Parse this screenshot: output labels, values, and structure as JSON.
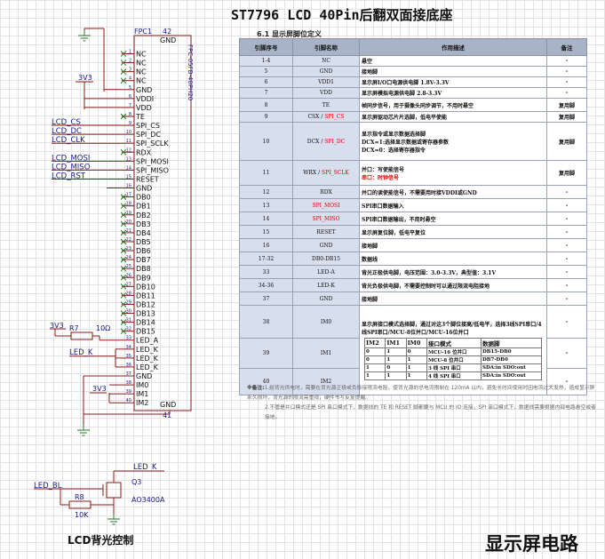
{
  "title": "ST7796 LCD 40Pin后翻双面接底座",
  "section_heading": "6.1 显示屏脚位定义",
  "table": {
    "headers": [
      "引脚序号",
      "引脚名称",
      "作用描述",
      "备注"
    ],
    "rows": [
      {
        "pin": "1-4",
        "name": "NC",
        "name_suffix": "",
        "desc": [
          "悬空"
        ],
        "note": "-"
      },
      {
        "pin": "5",
        "name": "GND",
        "name_suffix": "",
        "desc": [
          "接地脚"
        ],
        "note": "-"
      },
      {
        "pin": "6",
        "name": "VDD1",
        "name_suffix": "",
        "desc": [
          "显示屏I/O口电源供电脚 1.8V-3.3V"
        ],
        "note": "-"
      },
      {
        "pin": "7",
        "name": "VDD",
        "name_suffix": "",
        "desc": [
          "显示屏模拟电源供电脚 2.8-3.3V"
        ],
        "note": "-"
      },
      {
        "pin": "8",
        "name": "TE",
        "name_suffix": "",
        "desc": [
          "帧同步信号，用于摄像头同步调节，不用时悬空"
        ],
        "note": "复用脚"
      },
      {
        "pin": "9",
        "name": "CSX /",
        "name_suffix": " SPI_CS",
        "desc": [
          "显示屏驱动芯片片选脚，低电平使能"
        ],
        "note": "复用脚"
      },
      {
        "pin": "10",
        "name": "DCX /",
        "name_suffix": " SPI_DC",
        "desc": [
          "显示指令或显示数据选择脚",
          "DCX=1:选择显示数据或寄存器参数",
          "DCX=0：选择寄存器指令"
        ],
        "note": "复用脚"
      },
      {
        "pin": "11",
        "name": "WRX /",
        "name_suffix": " SPI_SCLK",
        "desc": [
          "并口：写使能信号",
          "串口：时钟信号"
        ],
        "note": "复用脚"
      },
      {
        "pin": "12",
        "name": "RDX",
        "name_suffix": "",
        "desc": [
          "并口的读使能信号，不需要用时接VDDI或GND"
        ],
        "note": "-"
      },
      {
        "pin": "13",
        "name": "SPI_MOSI",
        "name_suffix": "",
        "desc": [
          "SPI串口数据输入"
        ],
        "note": "-"
      },
      {
        "pin": "14",
        "name": "SPI_MISO",
        "name_suffix": "",
        "desc": [
          "SPI串口数据输出，不用时悬空"
        ],
        "note": "-"
      },
      {
        "pin": "15",
        "name": "RESET",
        "name_suffix": "",
        "desc": [
          "显示屏复位脚，低电平复位"
        ],
        "note": "-"
      },
      {
        "pin": "16",
        "name": "GND",
        "name_suffix": "",
        "desc": [
          "接地脚"
        ],
        "note": "-"
      },
      {
        "pin": "17-32",
        "name": "DB0-DB15",
        "name_suffix": "",
        "desc": [
          "数据线"
        ],
        "note": "-"
      },
      {
        "pin": "33",
        "name": "LED-A",
        "name_suffix": "",
        "desc": [
          "背光正极供电脚，电压范围：3.0-3.3V，典型值：3.1V"
        ],
        "note": "-"
      },
      {
        "pin": "34-36",
        "name": "LED-K",
        "name_suffix": "",
        "desc": [
          "背光负极供电脚，不需要控制时可以通过限流电阻接地"
        ],
        "note": "-"
      },
      {
        "pin": "37",
        "name": "GND",
        "name_suffix": "",
        "desc": [
          "接地脚"
        ],
        "note": "-"
      },
      {
        "pin": "38",
        "name": "IM0",
        "name_suffix": "",
        "desc": [
          "显示屏接口模式选择脚，通过对这3个脚位接高/低电平，选择3线SPI串口/4线SPI串口/MCU-8位并口/MCU-16位并口"
        ],
        "note": "-"
      },
      {
        "pin": "39",
        "name": "IM1",
        "name_suffix": "",
        "desc": [],
        "note": "-"
      },
      {
        "pin": "40",
        "name": "IM2",
        "name_suffix": "",
        "desc": [],
        "note": "-"
      }
    ],
    "im_headers": [
      "IM2",
      "IM1",
      "IM0",
      "接口模式",
      "数据脚"
    ],
    "im_rows": [
      [
        "0",
        "1",
        "0",
        "MCU-16 位并口",
        "DB15-DB0"
      ],
      [
        "0",
        "1",
        "1",
        "MCU-8 位并口",
        "DB7-DB0"
      ],
      [
        "1",
        "0",
        "1",
        "3 线 SPI 串口",
        "SDA:in    SDO:out"
      ],
      [
        "1",
        "1",
        "1",
        "4 线 SPI 串口",
        "SDA:in    SDO:out"
      ]
    ]
  },
  "notes": {
    "label": "※备注:",
    "n1": "1.给背光供电时，需要在背光源正极或负极接限流电阻，使背光源的总电流限制在 120mA 以内，避免长时间使用时因电流过大发热，造成显示屏永久损坏，背光源的限流需重视，硬件书写反复提醒。",
    "n2": "2.不管是并口模式还是 SPI 串口模式下，数据线的 TE 和 RESET 脚都要与 MCU 的 IO 连接，SPI 串口模式下，数据线需要根据内部电路悬空或者接地。"
  },
  "schematic": {
    "connector_ref": "FPC1",
    "connector_part": "FPC-05FB-40PH20",
    "pin_count_top": "42",
    "pin_count_bottom": "41",
    "gnd_label": "GND",
    "pin_labels": [
      "NC",
      "NC",
      "NC",
      "NC",
      "GND",
      "VDDI",
      "VDD",
      "TE",
      "SPI_CS",
      "SPI_DC",
      "SPI_SCLK",
      "RDX",
      "SPI_MOSI",
      "SPI_MISO",
      "RESET",
      "GND",
      "DB0",
      "DB1",
      "DB2",
      "DB3",
      "DB4",
      "DB5",
      "DB6",
      "DB7",
      "DB8",
      "DB9",
      "DB10",
      "DB11",
      "DB12",
      "DB13",
      "DB14",
      "DB15",
      "LED_A",
      "LED_K",
      "LED_K",
      "LED_K",
      "GND",
      "IM0",
      "IM1",
      "IM2"
    ],
    "pin_numbers": [
      "1",
      "2",
      "3",
      "4",
      "5",
      "6",
      "7",
      "8",
      "9",
      "10",
      "11",
      "12",
      "13",
      "14",
      "15",
      "16",
      "17",
      "18",
      "19",
      "20",
      "21",
      "22",
      "23",
      "24",
      "25",
      "26",
      "27",
      "28",
      "29",
      "30",
      "31",
      "32",
      "33",
      "34",
      "35",
      "36",
      "37",
      "38",
      "39",
      "40"
    ],
    "net_labels": {
      "cs": "LCD_CS",
      "dc": "LCD_DC",
      "clk": "LCD_CLK",
      "mosi": "LCD_MOSI",
      "miso": "LCD_MISO",
      "rst": "LCD_RST",
      "ledk": "LED_K",
      "ledbl": "LED_BL"
    },
    "v33": "3V3",
    "r7_ref": "R7",
    "r7_val": "10Ω",
    "q3_ref": "Q3",
    "q3_part": "AO3400A",
    "r8_ref": "R8",
    "r8_val": "10K",
    "backlight_title": "LCD背光控制",
    "circuit_title": "显示屏电路"
  }
}
